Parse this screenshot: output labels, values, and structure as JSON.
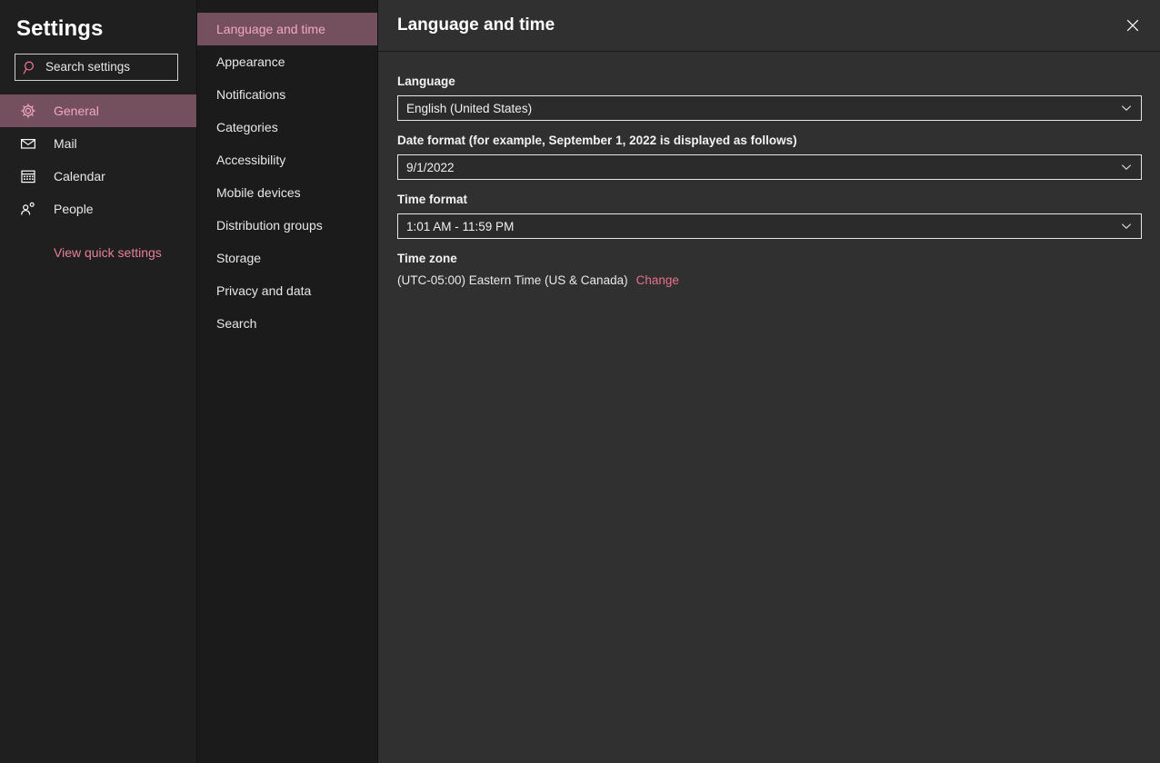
{
  "sidebar": {
    "title": "Settings",
    "search": {
      "placeholder": "Search settings",
      "icon": "search-icon"
    },
    "items": [
      {
        "label": "General",
        "icon": "gear-icon",
        "selected": true
      },
      {
        "label": "Mail",
        "icon": "envelope-icon",
        "selected": false
      },
      {
        "label": "Calendar",
        "icon": "calendar-icon",
        "selected": false
      },
      {
        "label": "People",
        "icon": "person-icon",
        "selected": false
      }
    ],
    "quick_link": "View quick settings"
  },
  "subnav": {
    "items": [
      {
        "label": "Language and time",
        "selected": true
      },
      {
        "label": "Appearance",
        "selected": false
      },
      {
        "label": "Notifications",
        "selected": false
      },
      {
        "label": "Categories",
        "selected": false
      },
      {
        "label": "Accessibility",
        "selected": false
      },
      {
        "label": "Mobile devices",
        "selected": false
      },
      {
        "label": "Distribution groups",
        "selected": false
      },
      {
        "label": "Storage",
        "selected": false
      },
      {
        "label": "Privacy and data",
        "selected": false
      },
      {
        "label": "Search",
        "selected": false
      }
    ]
  },
  "main": {
    "title": "Language and time",
    "close_icon": "close-icon",
    "fields": {
      "language": {
        "label": "Language",
        "value": "English (United States)",
        "chevron": "chevron-down-icon"
      },
      "date_format": {
        "label": "Date format (for example, September 1, 2022 is displayed as follows)",
        "value": "9/1/2022",
        "chevron": "chevron-down-icon"
      },
      "time_format": {
        "label": "Time format",
        "value": "1:01 AM - 11:59 PM",
        "chevron": "chevron-down-icon"
      },
      "time_zone": {
        "label": "Time zone",
        "value": "(UTC-05:00) Eastern Time (US & Canada)",
        "change_label": "Change"
      }
    }
  },
  "colors": {
    "accent_pink": "#e8708f",
    "selected_bg": "#74505f",
    "selected_text": "#f2a7bf",
    "sidebar_bg": "#1f1f1f",
    "subnav_bg": "#1b1b1b",
    "main_bg": "#303030"
  }
}
